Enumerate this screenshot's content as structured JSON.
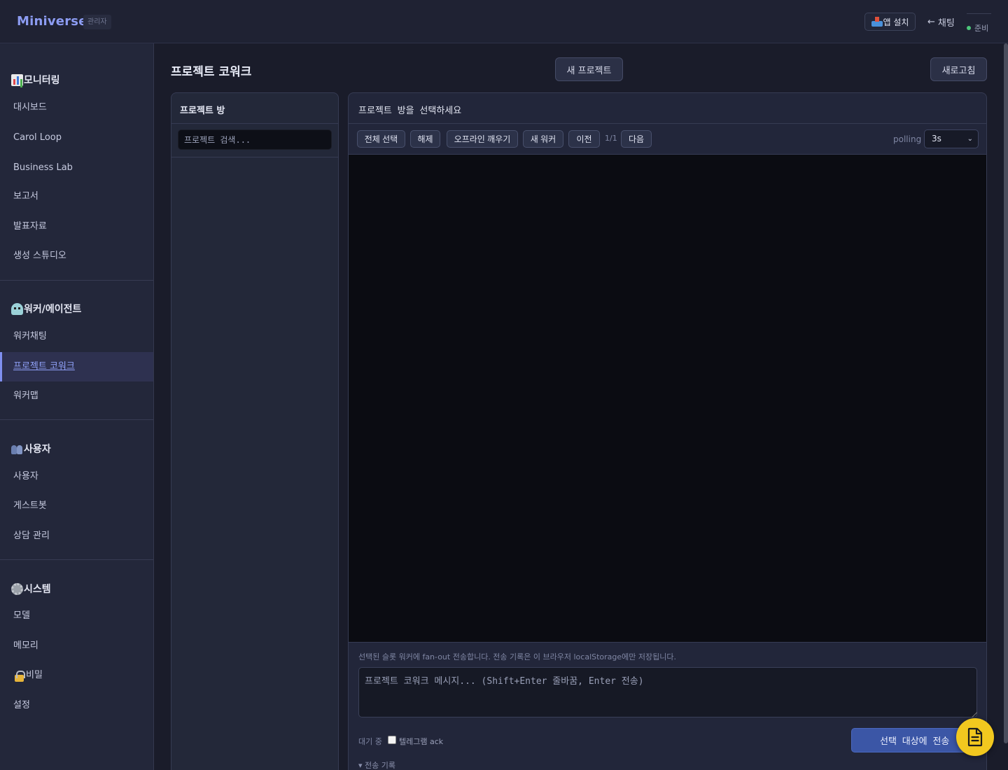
{
  "header": {
    "brand": "Miniverse",
    "role_badge": "관리자",
    "app_install_label": "앱 설치",
    "back_chat_label": "채팅",
    "status_text": "준비",
    "status_color": "#4cc67a"
  },
  "sidebar": {
    "groups": [
      {
        "title": "모니터링",
        "icon": "bar-chart-icon",
        "items": [
          "대시보드",
          "Carol Loop",
          "Business Lab",
          "보고서",
          "발표자료",
          "생성 스튜디오"
        ]
      },
      {
        "title": "워커/에이전트",
        "icon": "robot-icon",
        "items": [
          "워커채팅",
          "프로젝트 코워크",
          "워커맵"
        ]
      },
      {
        "title": "사용자",
        "icon": "users-icon",
        "items": [
          "사용자",
          "게스트봇",
          "상담 관리"
        ]
      },
      {
        "title": "시스템",
        "icon": "gear-icon",
        "items": [
          "모델",
          "메모리",
          "비밀",
          "설정"
        ]
      }
    ],
    "active_item": "프로젝트 코워크",
    "accent_color": "#8fa0f7"
  },
  "main": {
    "title": "프로젝트 코워크",
    "new_project_label": "새 프로젝트",
    "refresh_label": "새로고침"
  },
  "rooms": {
    "title": "프로젝트 방",
    "search_placeholder": "프로젝트 검색..."
  },
  "chat": {
    "title": "프로젝트 방을 선택하세요",
    "toolbar": {
      "select_all": "전체 선택",
      "deselect": "해제",
      "wake_offline": "오프라인 깨우기",
      "new_worker": "새 워커",
      "prev": "이전",
      "page": "1/1",
      "next": "다음",
      "polling_label": "polling",
      "polling_value": "3s"
    },
    "fanout_note": "선택된 슬롯 워커에 fan-out 전송합니다. 전송 기록은 이 브라우저 localStorage에만 저장됩니다.",
    "composer_placeholder": "프로젝트 코워크 메시지... (Shift+Enter 줄바꿈, Enter 전송)",
    "wait_status": "대기 중",
    "ack_label": "텔레그램 ack",
    "send_label": "선택 대상에 전송",
    "history_toggle": "▾ 전송 기록",
    "send_color": "#3b56a6"
  },
  "fab": {
    "icon": "document-icon",
    "color": "#f2c81f"
  }
}
